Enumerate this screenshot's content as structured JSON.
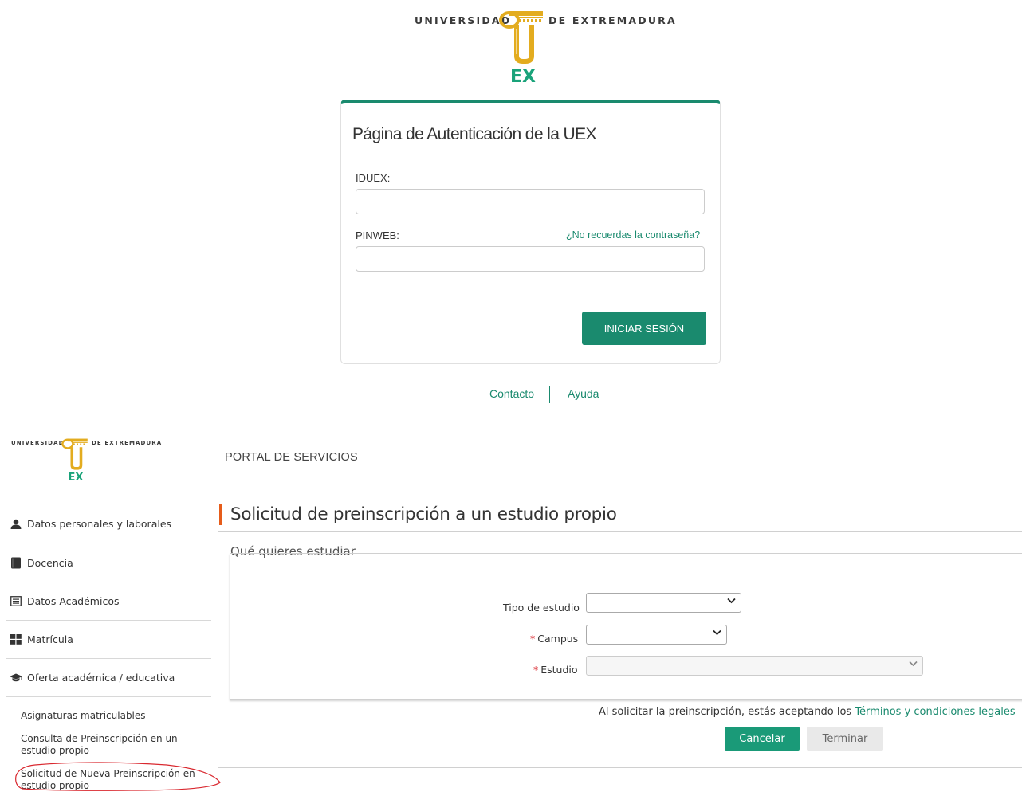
{
  "login": {
    "logo": {
      "word_left": "UNIVERSIDAD",
      "word_right": "DE EXTREMADURA",
      "mark": "EX"
    },
    "title": "Página de Autenticación de la UEX",
    "username_label": "IDUEX:",
    "username_value": "",
    "password_label": "PINWEB:",
    "password_value": "",
    "forgot_link": "¿No recuerdas la contraseña?",
    "submit_label": "INICIAR SESIÓN",
    "footer": {
      "contact": "Contacto",
      "help": "Ayuda"
    }
  },
  "portal": {
    "logo": {
      "word_left": "UNIVERSIDAD",
      "word_right": "DE EXTREMADURA",
      "mark": "EX"
    },
    "title": "PORTAL DE SERVICIOS",
    "sidebar": {
      "items": [
        {
          "label": "Datos personales y laborales",
          "icon": "user-icon"
        },
        {
          "label": "Docencia",
          "icon": "book-icon"
        },
        {
          "label": "Datos Académicos",
          "icon": "list-icon"
        },
        {
          "label": "Matrícula",
          "icon": "grid-icon"
        },
        {
          "label": "Oferta académica / educativa",
          "icon": "graduation-cap-icon"
        }
      ],
      "subitems": [
        {
          "label": "Asignaturas matriculables"
        },
        {
          "label": "Consulta de Preinscripción en un estudio propio"
        },
        {
          "label": "Solicitud de Nueva Preinscripción en estudio propio"
        }
      ]
    },
    "page_heading": "Solicitud de preinscripción a un estudio propio",
    "section_subtitle": "Qué quieres estudiar",
    "form": {
      "tipo_label": "Tipo de estudio",
      "tipo_value": "",
      "campus_label": "Campus",
      "campus_value": "",
      "estudio_label": "Estudio",
      "estudio_value": "",
      "required_marker": "*"
    },
    "terms_text": "Al solicitar la preinscripción, estás aceptando los ",
    "terms_link": "Términos y condiciones legales",
    "cancel_label": "Cancelar",
    "finish_label": "Terminar"
  },
  "colors": {
    "brand_green": "#1a8a6e",
    "accent_orange": "#e65c1a",
    "required_red": "#d9282f",
    "logo_gold": "#e3ac1f",
    "logo_green": "#1aa37a",
    "annotation_red": "#d9282f"
  }
}
